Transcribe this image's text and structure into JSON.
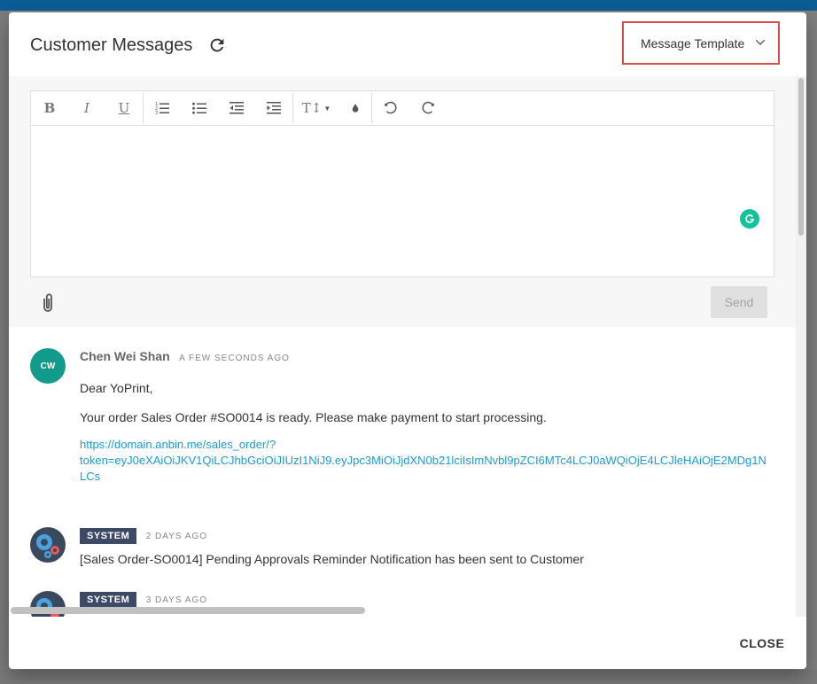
{
  "dialog": {
    "title": "Customer Messages",
    "template_button": "Message Template",
    "close_label": "CLOSE"
  },
  "composer": {
    "send_label": "Send",
    "toolbar": [
      "bold",
      "italic",
      "underline",
      "ordered-list",
      "bullet-list",
      "outdent",
      "indent",
      "font-size",
      "text-color",
      "undo",
      "redo"
    ]
  },
  "messages": [
    {
      "author": "Chen Wei Shan",
      "initials": "CW",
      "time": "A FEW SECONDS AGO",
      "lines": [
        "Dear YoPrint,",
        "Your order Sales Order #SO0014 is ready. Please make payment to start processing."
      ],
      "link_lines": [
        "https://domain.anbin.me/sales_order/?",
        "token=eyJ0eXAiOiJKV1QiLCJhbGciOiJIUzI1NiJ9.eyJpc3MiOiJjdXN0b21lciIsImNvbl9pZCI6MTc4LCJ0aWQiOjE4LCJleHAiOjE2MDg1N",
        "LCs"
      ]
    },
    {
      "badge": "SYSTEM",
      "time": "2 DAYS AGO",
      "text": "[Sales Order-SO0014] Pending Approvals Reminder Notification has been sent to Customer"
    },
    {
      "badge": "SYSTEM",
      "time": "3 DAYS AGO"
    }
  ],
  "colors": {
    "accent": "#1a9bd7",
    "highlight_border": "#e24a4a",
    "avatar": "#129a8a",
    "system_badge": "#3d4a66"
  }
}
